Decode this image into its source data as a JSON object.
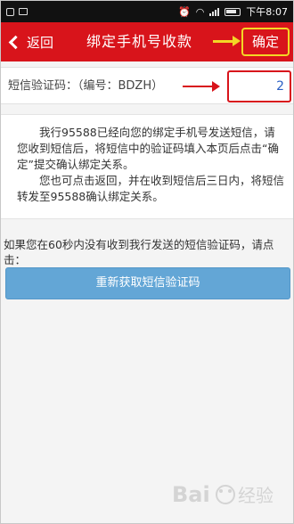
{
  "status_bar": {
    "time": "下午8:07"
  },
  "header": {
    "back_label": "返回",
    "title": "绑定手机号收款",
    "confirm_label": "确定"
  },
  "code_row": {
    "label": "短信验证码：（编号：BDZH）",
    "value": "2",
    "placeholder": ""
  },
  "info": {
    "paragraph1": "我行95588已经向您的绑定手机号发送短信，请您收到短信后，将短信中的验证码填入本页后点击“确定”提交确认绑定关系。",
    "paragraph2": "您也可点击返回，并在收到短信后三日内，将短信转发至95588确认绑定关系。"
  },
  "hint": "如果您在60秒内没有收到我行发送的短信验证码，请点击：",
  "resend_label": "重新获取短信验证码",
  "watermark": {
    "text": "Bai 经验"
  },
  "colors": {
    "header_red": "#d8141b",
    "highlight_yellow": "#f3d726",
    "button_blue": "#63a6d6",
    "status_bar": "#111111"
  }
}
